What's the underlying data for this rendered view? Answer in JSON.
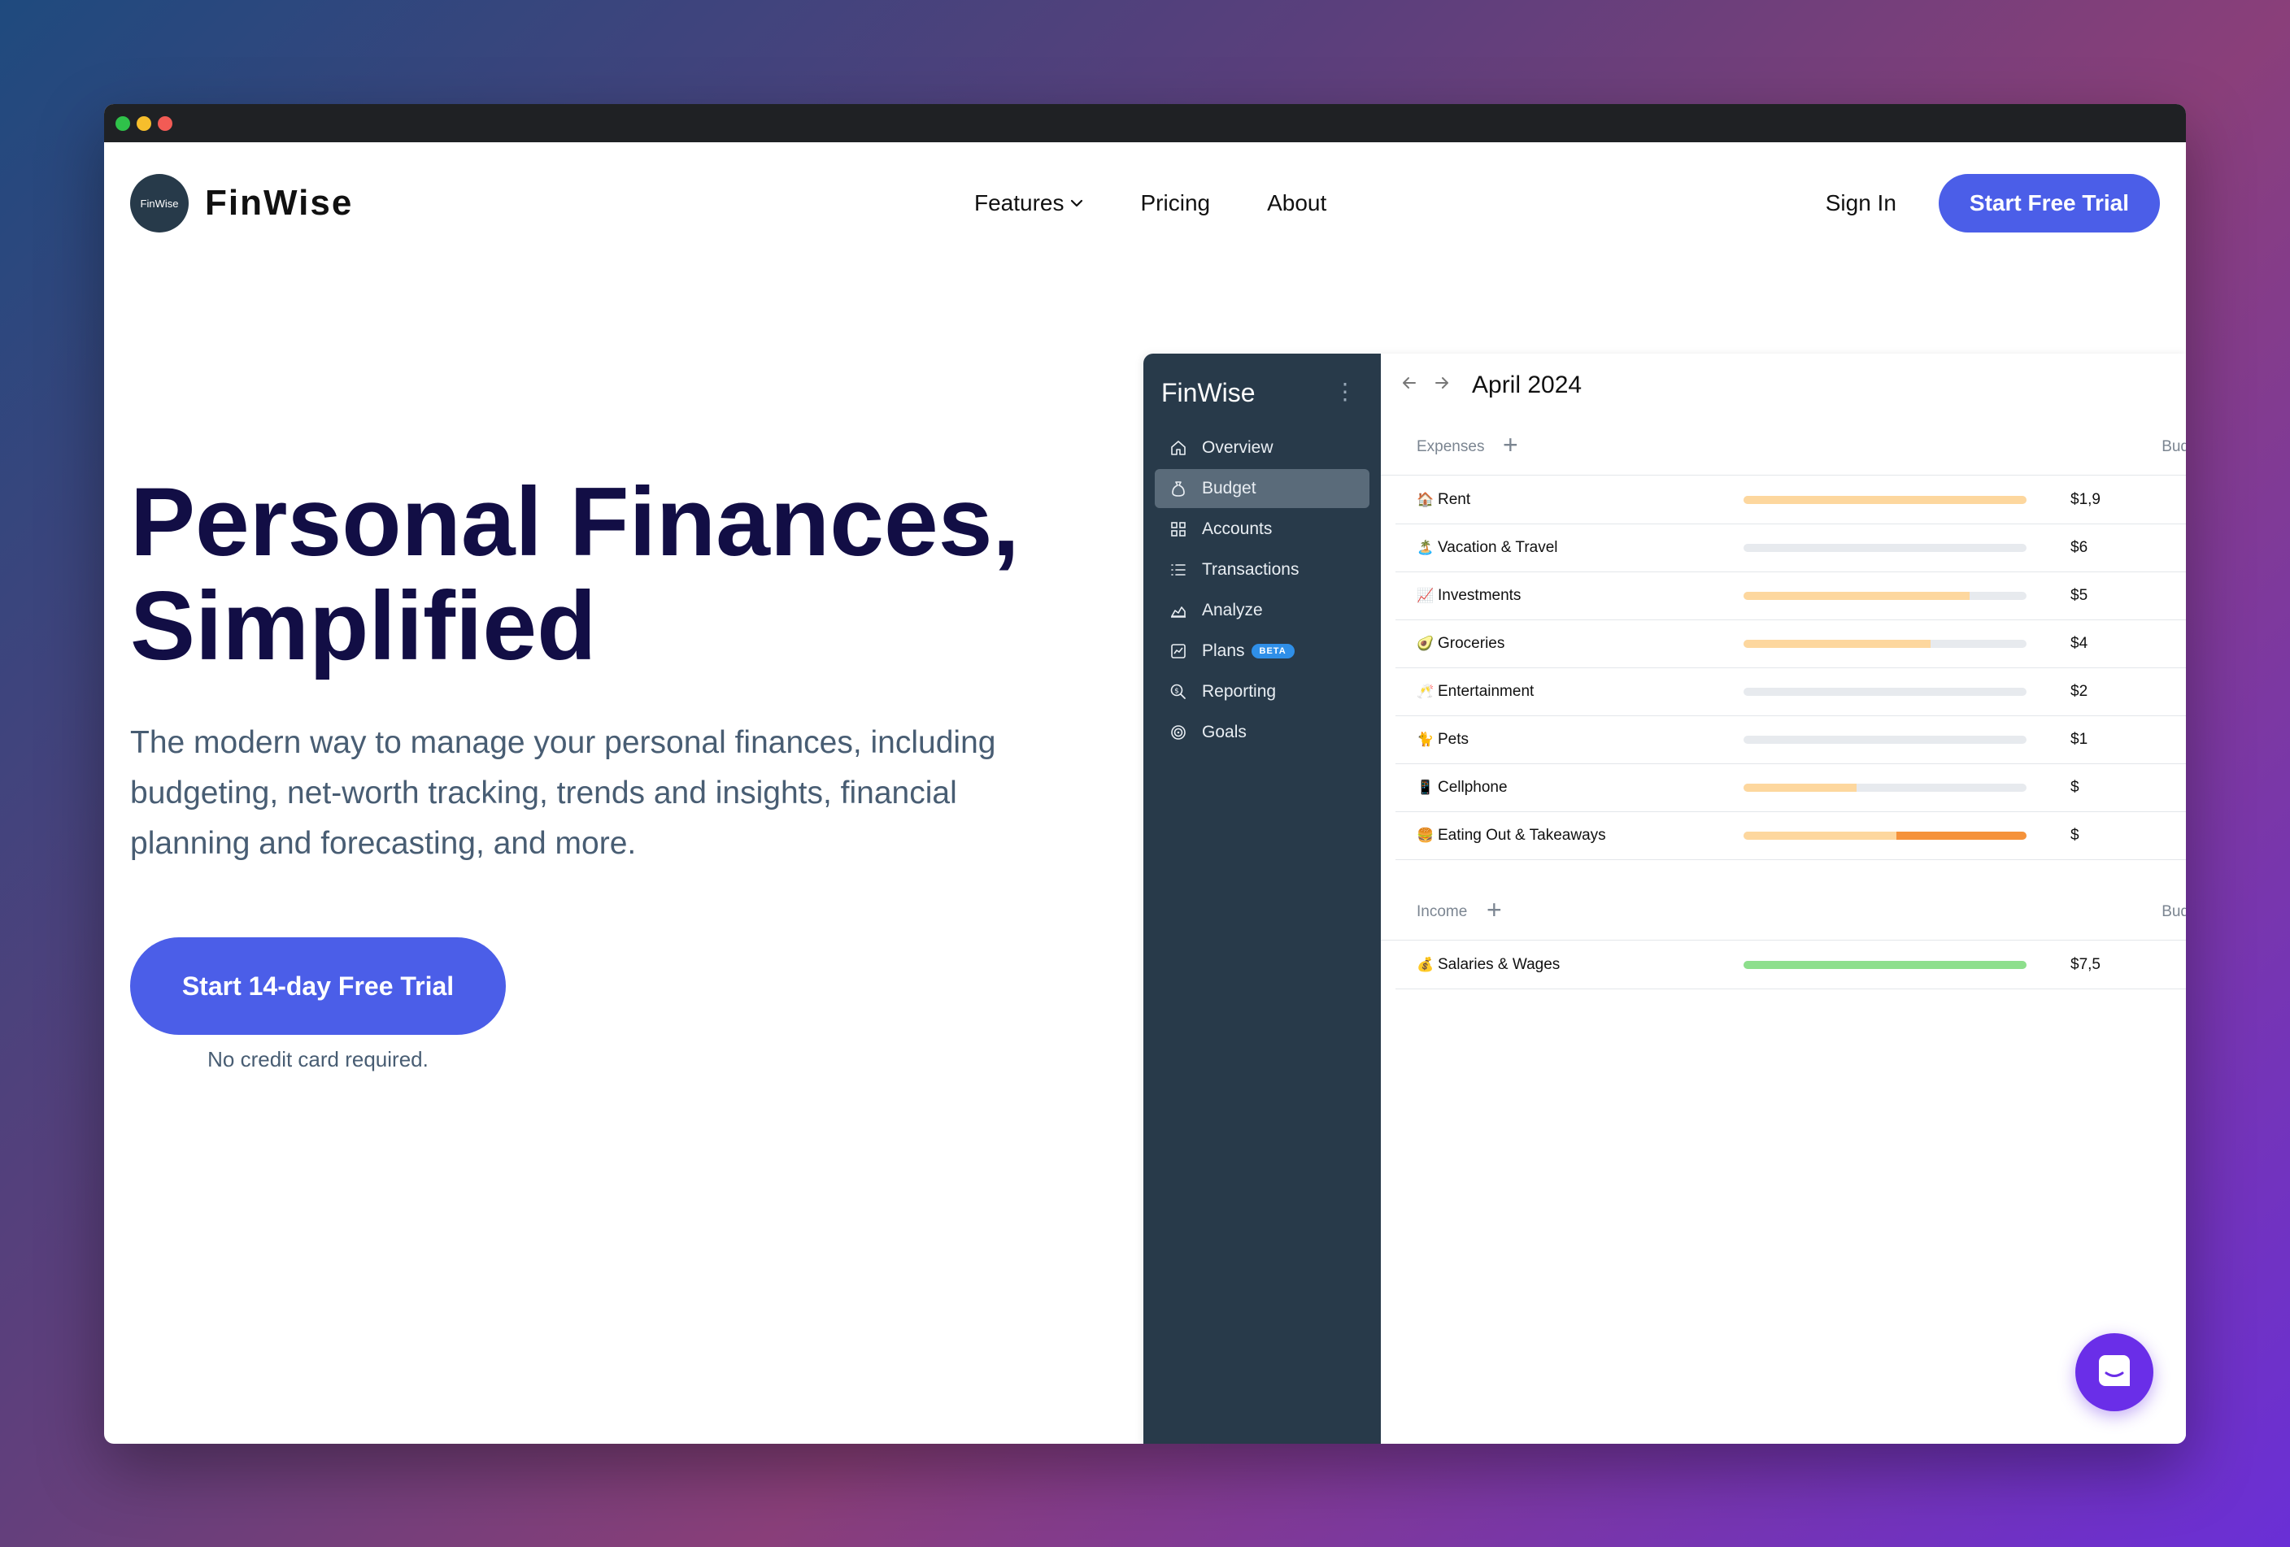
{
  "window": {
    "controls": [
      "close",
      "minimize",
      "maximize"
    ]
  },
  "nav": {
    "logo_text": "FinWise",
    "brand": "FinWise",
    "links": [
      {
        "label": "Features",
        "has_dropdown": true
      },
      {
        "label": "Pricing"
      },
      {
        "label": "About"
      }
    ],
    "signin": "Sign In",
    "cta": "Start Free Trial"
  },
  "hero": {
    "title_line1": "Personal Finances,",
    "title_line2": "Simplified",
    "subtitle": "The modern way to manage your personal finances, including budgeting, net-worth tracking, trends and insights, financial planning and forecasting, and more.",
    "cta": "Start 14-day Free Trial",
    "note": "No credit card required."
  },
  "app": {
    "sidebar": {
      "title": "FinWise",
      "items": [
        {
          "label": "Overview",
          "icon": "home-icon",
          "active": false
        },
        {
          "label": "Budget",
          "icon": "money-bag-icon",
          "active": true
        },
        {
          "label": "Accounts",
          "icon": "grid-icon",
          "active": false
        },
        {
          "label": "Transactions",
          "icon": "list-icon",
          "active": false
        },
        {
          "label": "Analyze",
          "icon": "area-chart-icon",
          "active": false
        },
        {
          "label": "Plans",
          "icon": "line-chart-icon",
          "active": false,
          "badge": "BETA"
        },
        {
          "label": "Reporting",
          "icon": "search-dollar-icon",
          "active": false
        },
        {
          "label": "Goals",
          "icon": "target-icon",
          "active": false
        }
      ]
    },
    "month": "April 2024",
    "expenses": {
      "label": "Expenses",
      "column": "Bud",
      "rows": [
        {
          "emoji": "🏠",
          "label": "Rent",
          "amount": "$1,9",
          "fill1": 1.0,
          "color1": "#fdd79e",
          "fill2": 0,
          "color2": ""
        },
        {
          "emoji": "🏝️",
          "label": "Vacation & Travel",
          "amount": "$6",
          "fill1": 0.0,
          "color1": "#fdd79e",
          "fill2": 0,
          "color2": ""
        },
        {
          "emoji": "📈",
          "label": "Investments",
          "amount": "$5",
          "fill1": 0.8,
          "color1": "#fdd79e",
          "fill2": 0,
          "color2": ""
        },
        {
          "emoji": "🥑",
          "label": "Groceries",
          "amount": "$4",
          "fill1": 0.66,
          "color1": "#fdd79e",
          "fill2": 0,
          "color2": ""
        },
        {
          "emoji": "🥂",
          "label": "Entertainment",
          "amount": "$2",
          "fill1": 0.0,
          "color1": "#fdd79e",
          "fill2": 0,
          "color2": ""
        },
        {
          "emoji": "🐈",
          "label": "Pets",
          "amount": "$1",
          "fill1": 0.0,
          "color1": "#fdd79e",
          "fill2": 0,
          "color2": ""
        },
        {
          "emoji": "📱",
          "label": "Cellphone",
          "amount": "$",
          "fill1": 0.4,
          "color1": "#fdd79e",
          "fill2": 0,
          "color2": ""
        },
        {
          "emoji": "🍔",
          "label": "Eating Out & Takeaways",
          "amount": "$",
          "fill1": 0.54,
          "color1": "#fdd79e",
          "fill2": 0.46,
          "color2": "#f5923a"
        }
      ]
    },
    "income": {
      "label": "Income",
      "column": "Bud",
      "rows": [
        {
          "emoji": "💰",
          "label": "Salaries & Wages",
          "amount": "$7,5",
          "fill1": 1.0,
          "color1": "#8ddf8c",
          "fill2": 0,
          "color2": ""
        }
      ]
    }
  },
  "chat": {
    "icon": "chat-icon"
  },
  "colors": {
    "accent": "#4b5ee8",
    "sidebar": "#283a4a",
    "heading": "#120e45",
    "chat": "#6a2ee8"
  }
}
